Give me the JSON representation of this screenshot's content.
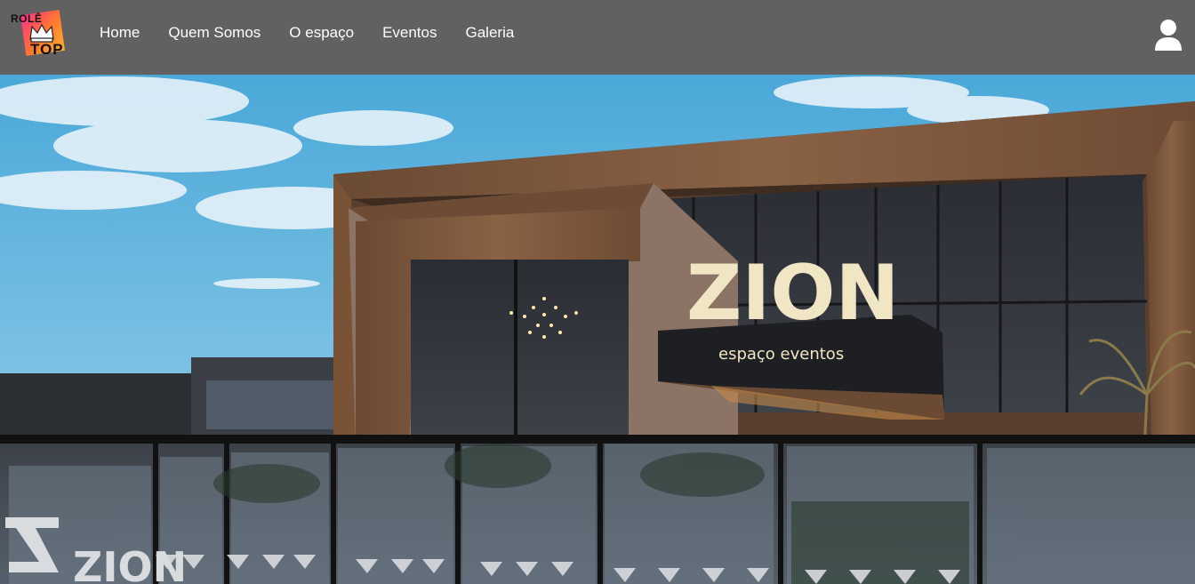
{
  "logo": {
    "line1": "ROLÊ",
    "line2": "TOP",
    "icon": "crown-icon"
  },
  "nav": {
    "items": [
      {
        "label": "Home"
      },
      {
        "label": "Quem Somos"
      },
      {
        "label": "O espaço"
      },
      {
        "label": "Eventos"
      },
      {
        "label": "Galeria"
      }
    ],
    "user_icon": "user-icon"
  },
  "hero": {
    "sign_text": "ZION",
    "sign_subtext": "espaço eventos",
    "fence_text": "ZION"
  },
  "colors": {
    "navbar": "#616161",
    "sky": "#5bb6e0",
    "wood": "#7a5236"
  }
}
